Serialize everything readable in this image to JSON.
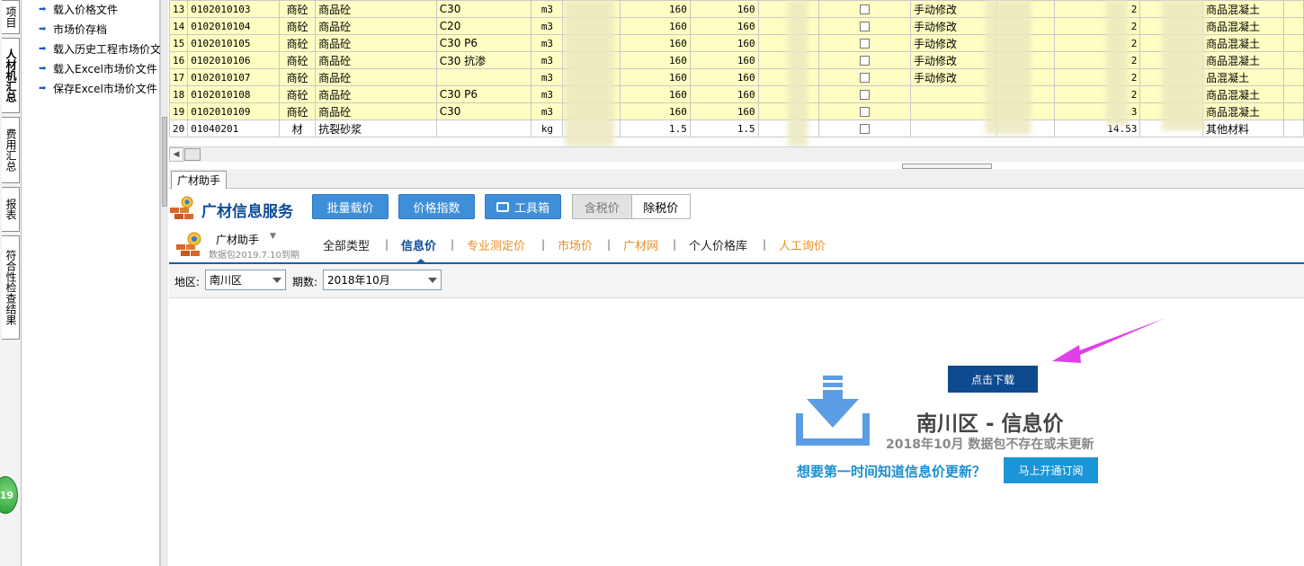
{
  "vertical_tabs": [
    "项目",
    "人材机汇总",
    "费用汇总",
    "报表",
    "符合性检查结果"
  ],
  "badge": "19",
  "left_actions": [
    "载入价格文件",
    "市场价存档",
    "载入历史工程市场价文",
    "载入Excel市场价文件",
    "保存Excel市场价文件"
  ],
  "grid": {
    "rows": [
      {
        "no": "13",
        "code": "0102010103",
        "type": "商砼",
        "name": "商品砼",
        "spec": "C30",
        "unit": "m3",
        "p1": "160",
        "p2": "160",
        "status": "手动修改",
        "v2": "2",
        "cat": "商品混凝土",
        "hl": true
      },
      {
        "no": "14",
        "code": "0102010104",
        "type": "商砼",
        "name": "商品砼",
        "spec": "C20",
        "unit": "m3",
        "p1": "160",
        "p2": "160",
        "status": "手动修改",
        "v2": "2",
        "cat": "商品混凝土",
        "hl": true
      },
      {
        "no": "15",
        "code": "0102010105",
        "type": "商砼",
        "name": "商品砼",
        "spec": "C30 P6",
        "unit": "m3",
        "p1": "160",
        "p2": "160",
        "status": "手动修改",
        "v2": "2",
        "cat": "商品混凝土",
        "hl": true
      },
      {
        "no": "16",
        "code": "0102010106",
        "type": "商砼",
        "name": "商品砼",
        "spec": "C30 抗渗",
        "unit": "m3",
        "p1": "160",
        "p2": "160",
        "status": "手动修改",
        "v2": "2",
        "cat": "商品混凝土",
        "hl": true
      },
      {
        "no": "17",
        "code": "0102010107",
        "type": "商砼",
        "name": "商品砼",
        "spec": "",
        "unit": "m3",
        "p1": "160",
        "p2": "160",
        "status": "手动修改",
        "v2": "2",
        "cat": "品混凝土",
        "hl": true
      },
      {
        "no": "18",
        "code": "0102010108",
        "type": "商砼",
        "name": "商品砼",
        "spec": "C30 P6",
        "unit": "m3",
        "p1": "160",
        "p2": "160",
        "status": "",
        "v2": "2",
        "cat": "商品混凝土",
        "hl": true
      },
      {
        "no": "19",
        "code": "0102010109",
        "type": "商砼",
        "name": "商品砼",
        "spec": "C30",
        "unit": "m3",
        "p1": "160",
        "p2": "160",
        "status": "",
        "v2": "3",
        "cat": "商品混凝土",
        "hl": true
      },
      {
        "no": "20",
        "code": "01040201",
        "type": "材",
        "name": "抗裂砂浆",
        "spec": "",
        "unit": "kg",
        "p1": "1.5",
        "p2": "1.5",
        "status": "",
        "v2": "14.53",
        "cat": "其他材料",
        "hl": false
      }
    ]
  },
  "assistant_tab": "广材助手",
  "service": {
    "title": "广材信息服务",
    "buttons": [
      "批量载价",
      "价格指数",
      "工具箱"
    ],
    "tax_included": "含税价",
    "tax_excluded": "除税价"
  },
  "helper": {
    "name": "广材助手",
    "sub": "数据包2019.7.10到期"
  },
  "nav_tabs": [
    "全部类型",
    "信息价",
    "专业测定价",
    "市场价",
    "广材网",
    "个人价格库",
    "人工询价"
  ],
  "filter": {
    "region_label": "地区:",
    "region": "南川区",
    "period_label": "期数:",
    "period": "2018年10月"
  },
  "empty": {
    "download": "点击下载",
    "title": "南川区 - 信息价",
    "subtitle": "2018年10月 数据包不存在或未更新",
    "prompt": "想要第一时间知道信息价更新？",
    "subscribe": "马上开通订阅"
  },
  "colors": {
    "accent": "#3f8fd8",
    "brand": "#0f4d9a",
    "row_highlight": "#fefec2",
    "arrow": "#e040e8",
    "orange_tab": "#e8902a"
  }
}
